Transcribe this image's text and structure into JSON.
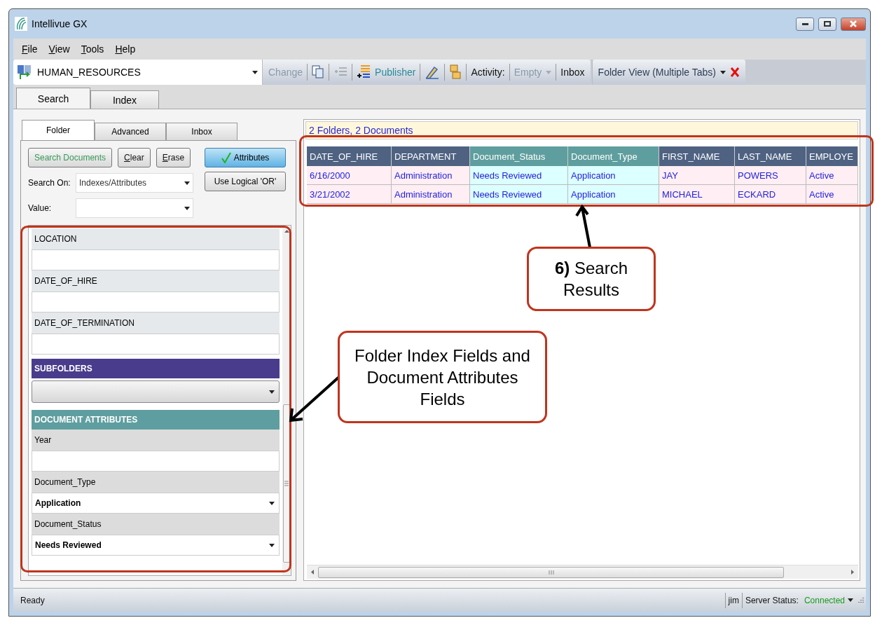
{
  "window": {
    "title": "Intellivue GX"
  },
  "menu": [
    "File",
    "View",
    "Tools",
    "Help"
  ],
  "toolbar": {
    "cabinet": "HUMAN_RESOURCES",
    "items": [
      {
        "kind": "text",
        "label": "Change",
        "disabled": true
      },
      {
        "kind": "icon",
        "disabled": false
      },
      {
        "kind": "icon",
        "disabled": true
      },
      {
        "kind": "icon_text",
        "label": "Publisher",
        "disabled": false
      },
      {
        "kind": "icon",
        "disabled": false
      },
      {
        "kind": "icon",
        "disabled": false
      },
      {
        "kind": "label",
        "label": "Activity:",
        "disabled": false
      },
      {
        "kind": "dropdown",
        "label": "Empty",
        "disabled": true
      },
      {
        "kind": "text",
        "label": "Inbox",
        "disabled": false
      }
    ],
    "view": {
      "label": "Folder View (Multiple Tabs)"
    }
  },
  "main_tabs": [
    {
      "label": "Search",
      "selected": true
    },
    {
      "label": "Index",
      "selected": false
    }
  ],
  "search_tabs": [
    {
      "label": "Folder",
      "selected": true
    },
    {
      "label": "Advanced",
      "selected": false
    },
    {
      "label": "Inbox",
      "selected": false
    }
  ],
  "buttons": [
    {
      "label": "Search Documents",
      "kind": "primary"
    },
    {
      "label": "Clear",
      "kind": "plain"
    },
    {
      "label": "Erase",
      "kind": "plain"
    }
  ],
  "toggles": [
    {
      "label": "Attributes",
      "on": true
    },
    {
      "label": "Use Logical 'OR'",
      "on": false
    }
  ],
  "search_on": {
    "label": "Search On:",
    "value": "Indexes/Attributes"
  },
  "value_field": {
    "label": "Value:"
  },
  "form_items": [
    {
      "kind": "index",
      "label": "LOCATION"
    },
    {
      "kind": "index",
      "label": "DATE_OF_HIRE"
    },
    {
      "kind": "index",
      "label": "DATE_OF_TERMINATION"
    },
    {
      "kind": "header",
      "label": "SUBFOLDERS",
      "color": "#4a3c8c"
    },
    {
      "kind": "select"
    },
    {
      "kind": "header",
      "label": "DOCUMENT ATTRIBUTES",
      "color": "#5f9ea0"
    },
    {
      "kind": "text",
      "label": "Year"
    },
    {
      "kind": "choice",
      "label": "Document_Type",
      "value": "Application"
    },
    {
      "kind": "choice",
      "label": "Document_Status",
      "value": "Needs Reviewed"
    }
  ],
  "results": {
    "summary": "2 Folders, 2 Documents",
    "columns": [
      {
        "label": "DATE_OF_HIRE",
        "kind": "folder"
      },
      {
        "label": "DEPARTMENT",
        "kind": "folder"
      },
      {
        "label": "Document_Status",
        "kind": "document"
      },
      {
        "label": "Document_Type",
        "kind": "document"
      },
      {
        "label": "FIRST_NAME",
        "kind": "folder"
      },
      {
        "label": "LAST_NAME",
        "kind": "folder"
      },
      {
        "label": "EMPLOYE",
        "kind": "folder"
      }
    ],
    "rows": [
      [
        "6/16/2000",
        "Administration",
        "Needs Reviewed",
        "Application",
        "JAY",
        "POWERS",
        "Active"
      ],
      [
        "3/21/2002",
        "Administration",
        "Needs Reviewed",
        "Application",
        "MICHAEL",
        "ECKARD",
        "Active"
      ]
    ]
  },
  "status_bar": {
    "message": "Ready",
    "user": "jim",
    "server_label": "Server Status:",
    "server_status": "Connected"
  },
  "callouts": [
    {
      "text": "**6)** Search Results"
    },
    {
      "text": "Folder Index Fields and Document Attributes Fields"
    }
  ]
}
